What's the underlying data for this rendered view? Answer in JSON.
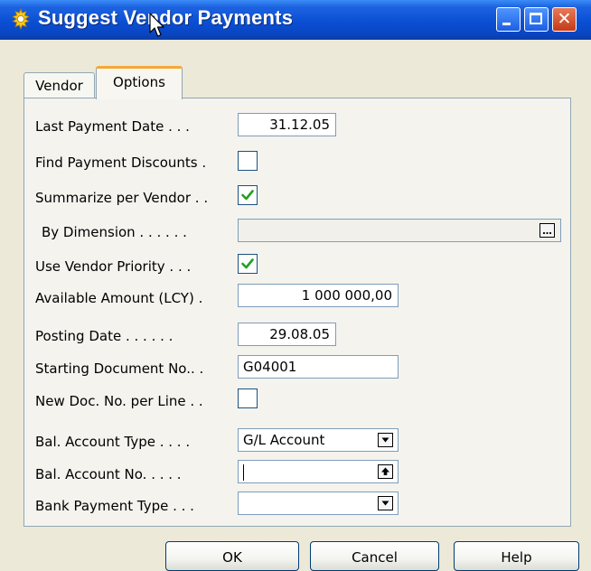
{
  "window": {
    "title": "Suggest Vendor Payments"
  },
  "tabs": [
    {
      "label": "Vendor",
      "active": false
    },
    {
      "label": "Options",
      "active": true
    }
  ],
  "fields": {
    "last_payment_date": {
      "label": "Last Payment Date . . .",
      "value": "31.12.05"
    },
    "find_payment_discounts": {
      "label": "Find Payment Discounts .",
      "checked": false
    },
    "summarize_per_vendor": {
      "label": "Summarize per Vendor . .",
      "checked": true
    },
    "by_dimension": {
      "label": "By Dimension . . . . . .",
      "value": ""
    },
    "use_vendor_priority": {
      "label": "Use Vendor Priority . . .",
      "checked": true
    },
    "available_amount": {
      "label": "Available Amount (LCY) .",
      "value": "1 000 000,00"
    },
    "posting_date": {
      "label": "Posting Date . . . . . .",
      "value": "29.08.05"
    },
    "starting_document_no": {
      "label": "Starting Document No.. .",
      "value": "G04001"
    },
    "new_doc_no_per_line": {
      "label": "New Doc. No. per Line . .",
      "checked": false
    },
    "bal_account_type": {
      "label": "Bal. Account Type . . . .",
      "value": "G/L Account"
    },
    "bal_account_no": {
      "label": "Bal. Account No. . . . .",
      "value": ""
    },
    "bank_payment_type": {
      "label": "Bank Payment Type . . .",
      "value": ""
    }
  },
  "buttons": {
    "ok": "OK",
    "cancel": "Cancel",
    "help": "Help"
  },
  "colors": {
    "title_bar": "#0a4fd4",
    "active_tab_accent": "#f6a833",
    "checkmark": "#21a121",
    "close_button": "#c43a16"
  }
}
